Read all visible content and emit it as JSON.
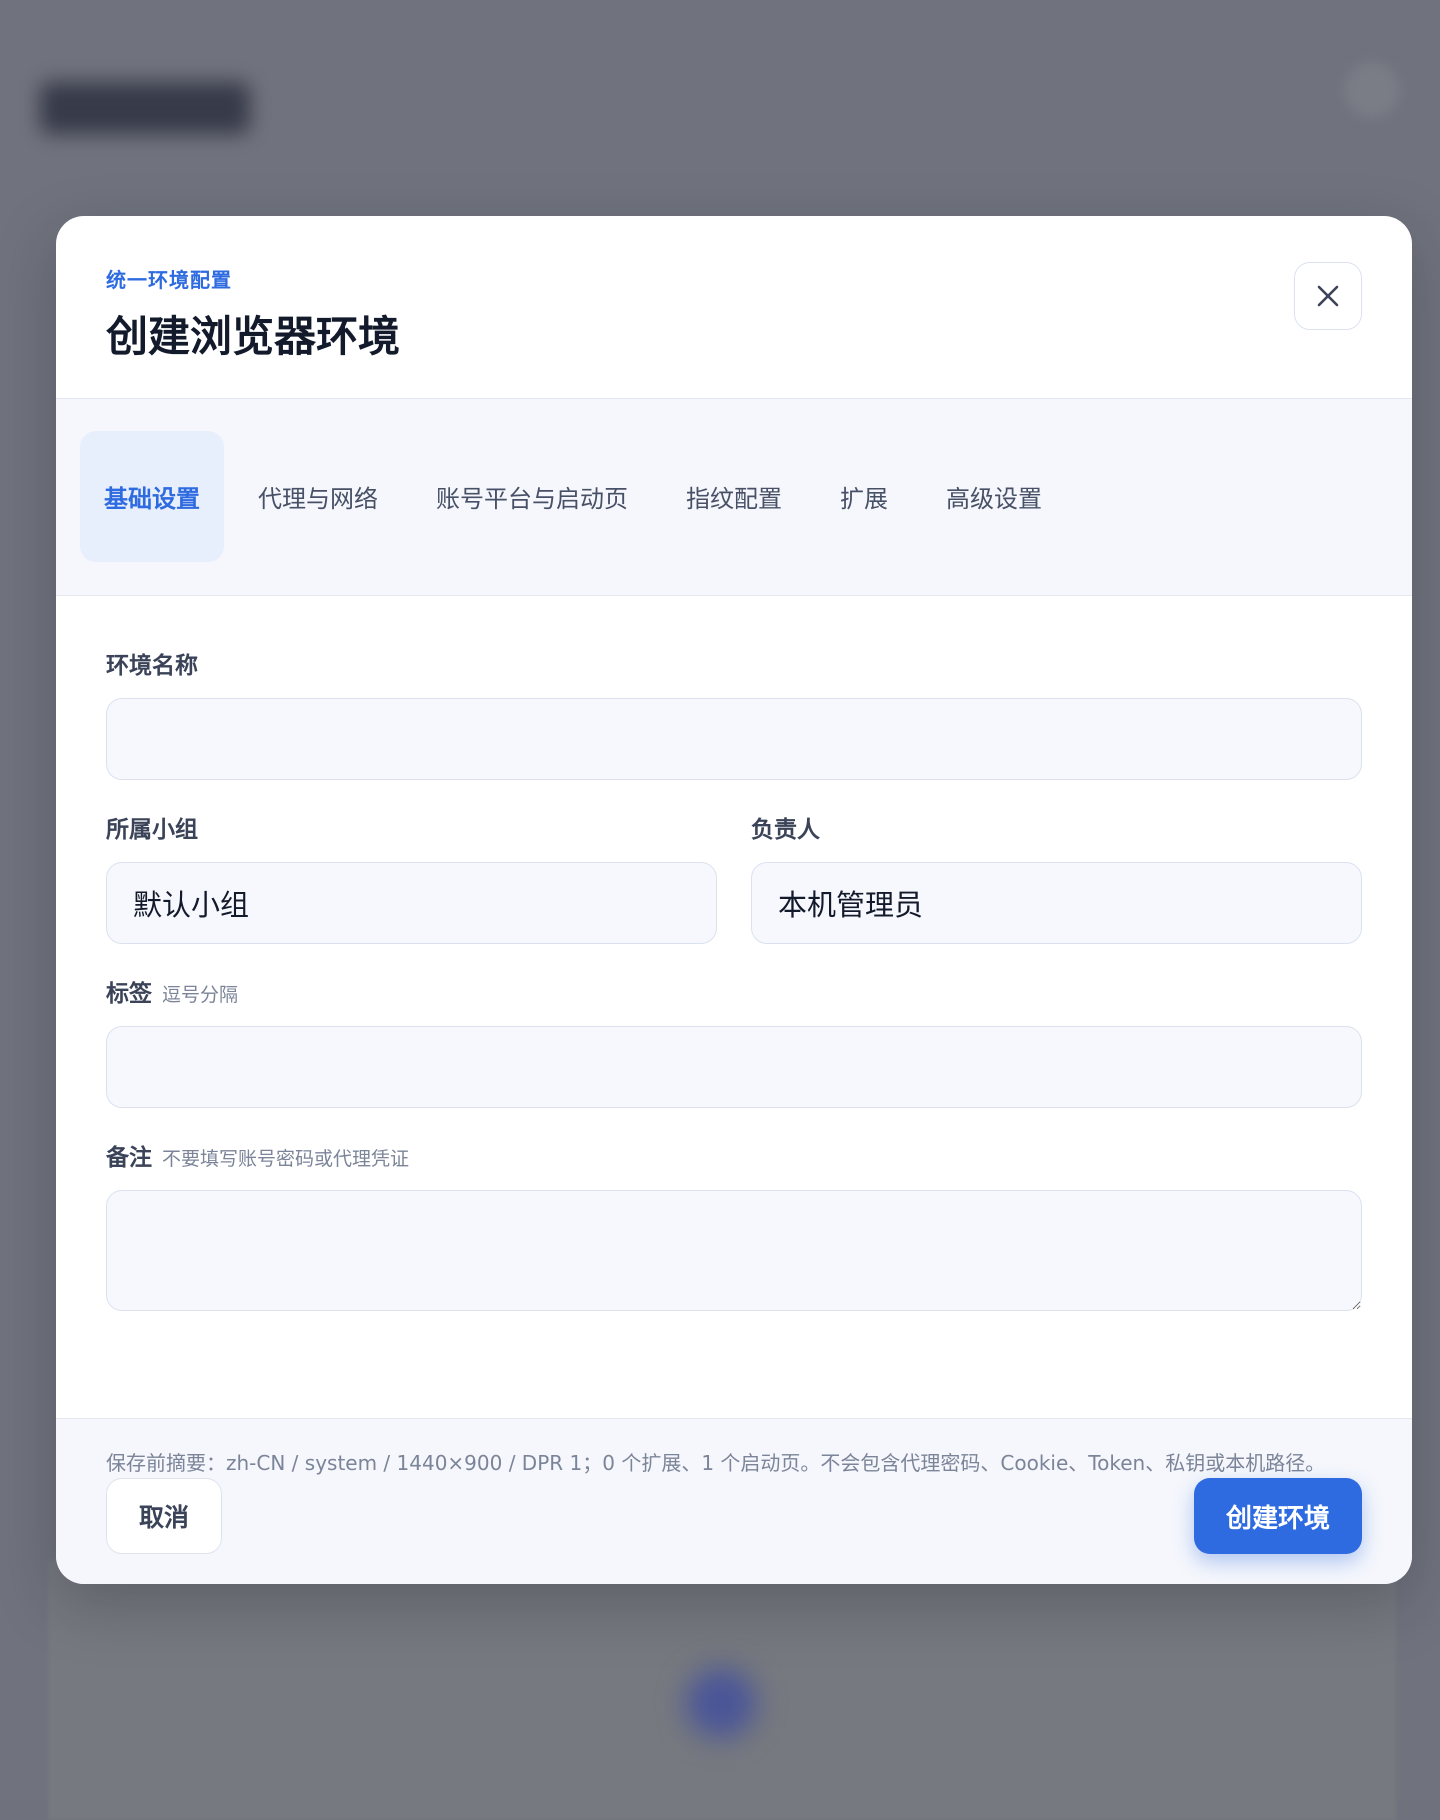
{
  "dialog": {
    "eyebrow": "统一环境配置",
    "title": "创建浏览器环境",
    "close_icon": "close-icon"
  },
  "tabs": [
    {
      "label": "基础设置",
      "active": true
    },
    {
      "label": "代理与网络",
      "active": false
    },
    {
      "label": "账号平台与启动页",
      "active": false
    },
    {
      "label": "指纹配置",
      "active": false
    },
    {
      "label": "扩展",
      "active": false
    },
    {
      "label": "高级设置",
      "active": false
    }
  ],
  "form": {
    "env_name": {
      "label": "环境名称",
      "value": ""
    },
    "group": {
      "label": "所属小组",
      "value": "默认小组"
    },
    "owner": {
      "label": "负责人",
      "value": "本机管理员"
    },
    "tags": {
      "label": "标签",
      "hint": "逗号分隔",
      "value": ""
    },
    "notes": {
      "label": "备注",
      "hint": "不要填写账号密码或代理凭证",
      "value": ""
    }
  },
  "footer": {
    "summary": "保存前摘要：zh-CN / system / 1440×900 / DPR 1；0 个扩展、1 个启动页。不会包含代理密码、Cookie、Token、私钥或本机路径。",
    "cancel_label": "取消",
    "create_label": "创建环境"
  },
  "colors": {
    "accent": "#2e6be0",
    "overlay": "#70737d"
  }
}
